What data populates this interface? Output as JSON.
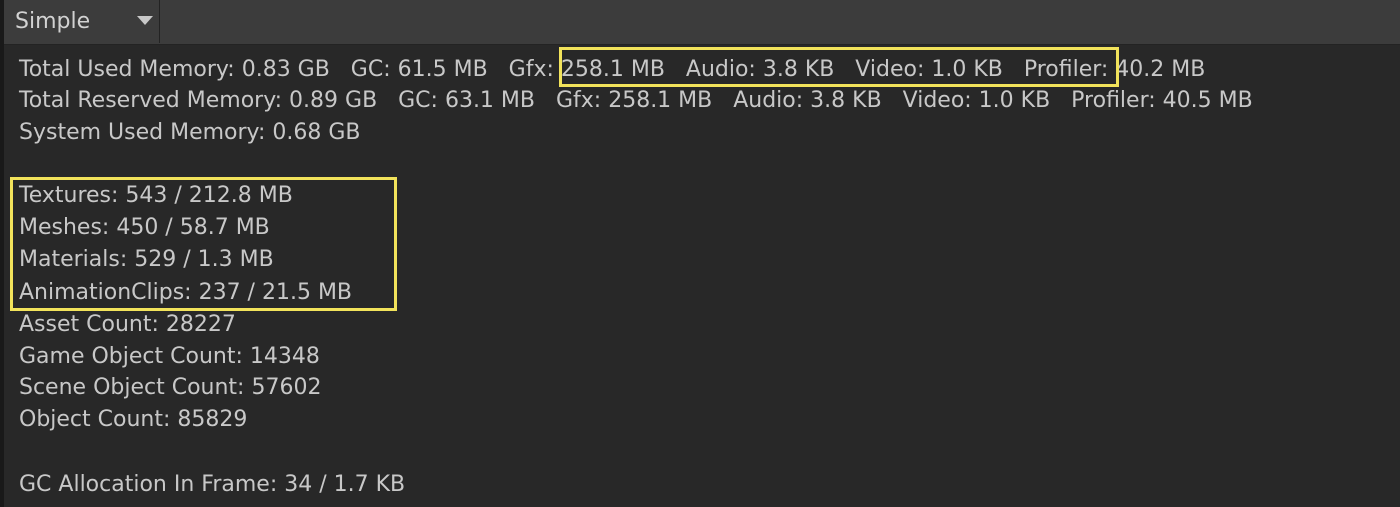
{
  "toolbar": {
    "mode_label": "Simple",
    "mode_icon": "chevron-down-icon"
  },
  "memory": {
    "total_used": "Total Used Memory: 0.83 GB   GC: 61.5 MB   Gfx: 258.1 MB   Audio: 3.8 KB   Video: 1.0 KB   Profiler: 40.2 MB",
    "total_reserved": "Total Reserved Memory: 0.89 GB   GC: 63.1 MB   Gfx: 258.1 MB   Audio: 3.8 KB   Video: 1.0 KB   Profiler: 40.5 MB",
    "system_used": "System Used Memory: 0.68 GB"
  },
  "assets": {
    "textures": "Textures: 543 / 212.8 MB",
    "meshes": "Meshes: 450 / 58.7 MB",
    "materials": "Materials: 529 / 1.3 MB",
    "animation_clips": "AnimationClips: 237 / 21.5 MB",
    "asset_count": "Asset Count: 28227",
    "game_object_count": "Game Object Count: 14348",
    "scene_object_count": "Scene Object Count: 57602",
    "object_count": "Object Count: 85829"
  },
  "gc": {
    "allocation_in_frame": "GC Allocation In Frame: 34 / 1.7 KB"
  },
  "highlight_color": "#f2e35b"
}
